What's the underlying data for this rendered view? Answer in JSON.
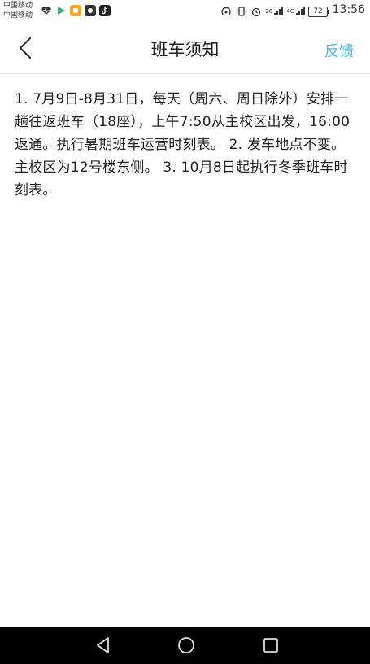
{
  "status_bar": {
    "carrier_1": "中国移动",
    "carrier_2": "中国移动",
    "battery": "72",
    "time": "13:56",
    "signal_labels": [
      "26",
      "4G"
    ]
  },
  "header": {
    "title": "班车须知",
    "feedback_label": "反馈"
  },
  "content": {
    "notice_text": "1. 7月9日-8月31日，每天（周六、周日除外）安排一趟往返班车（18座），上午7:50从主校区出发，16:00返通。执行暑期班车运营时刻表。 2. 发车地点不变。主校区为12号楼东侧。 3. 10月8日起执行冬季班车时刻表。"
  }
}
